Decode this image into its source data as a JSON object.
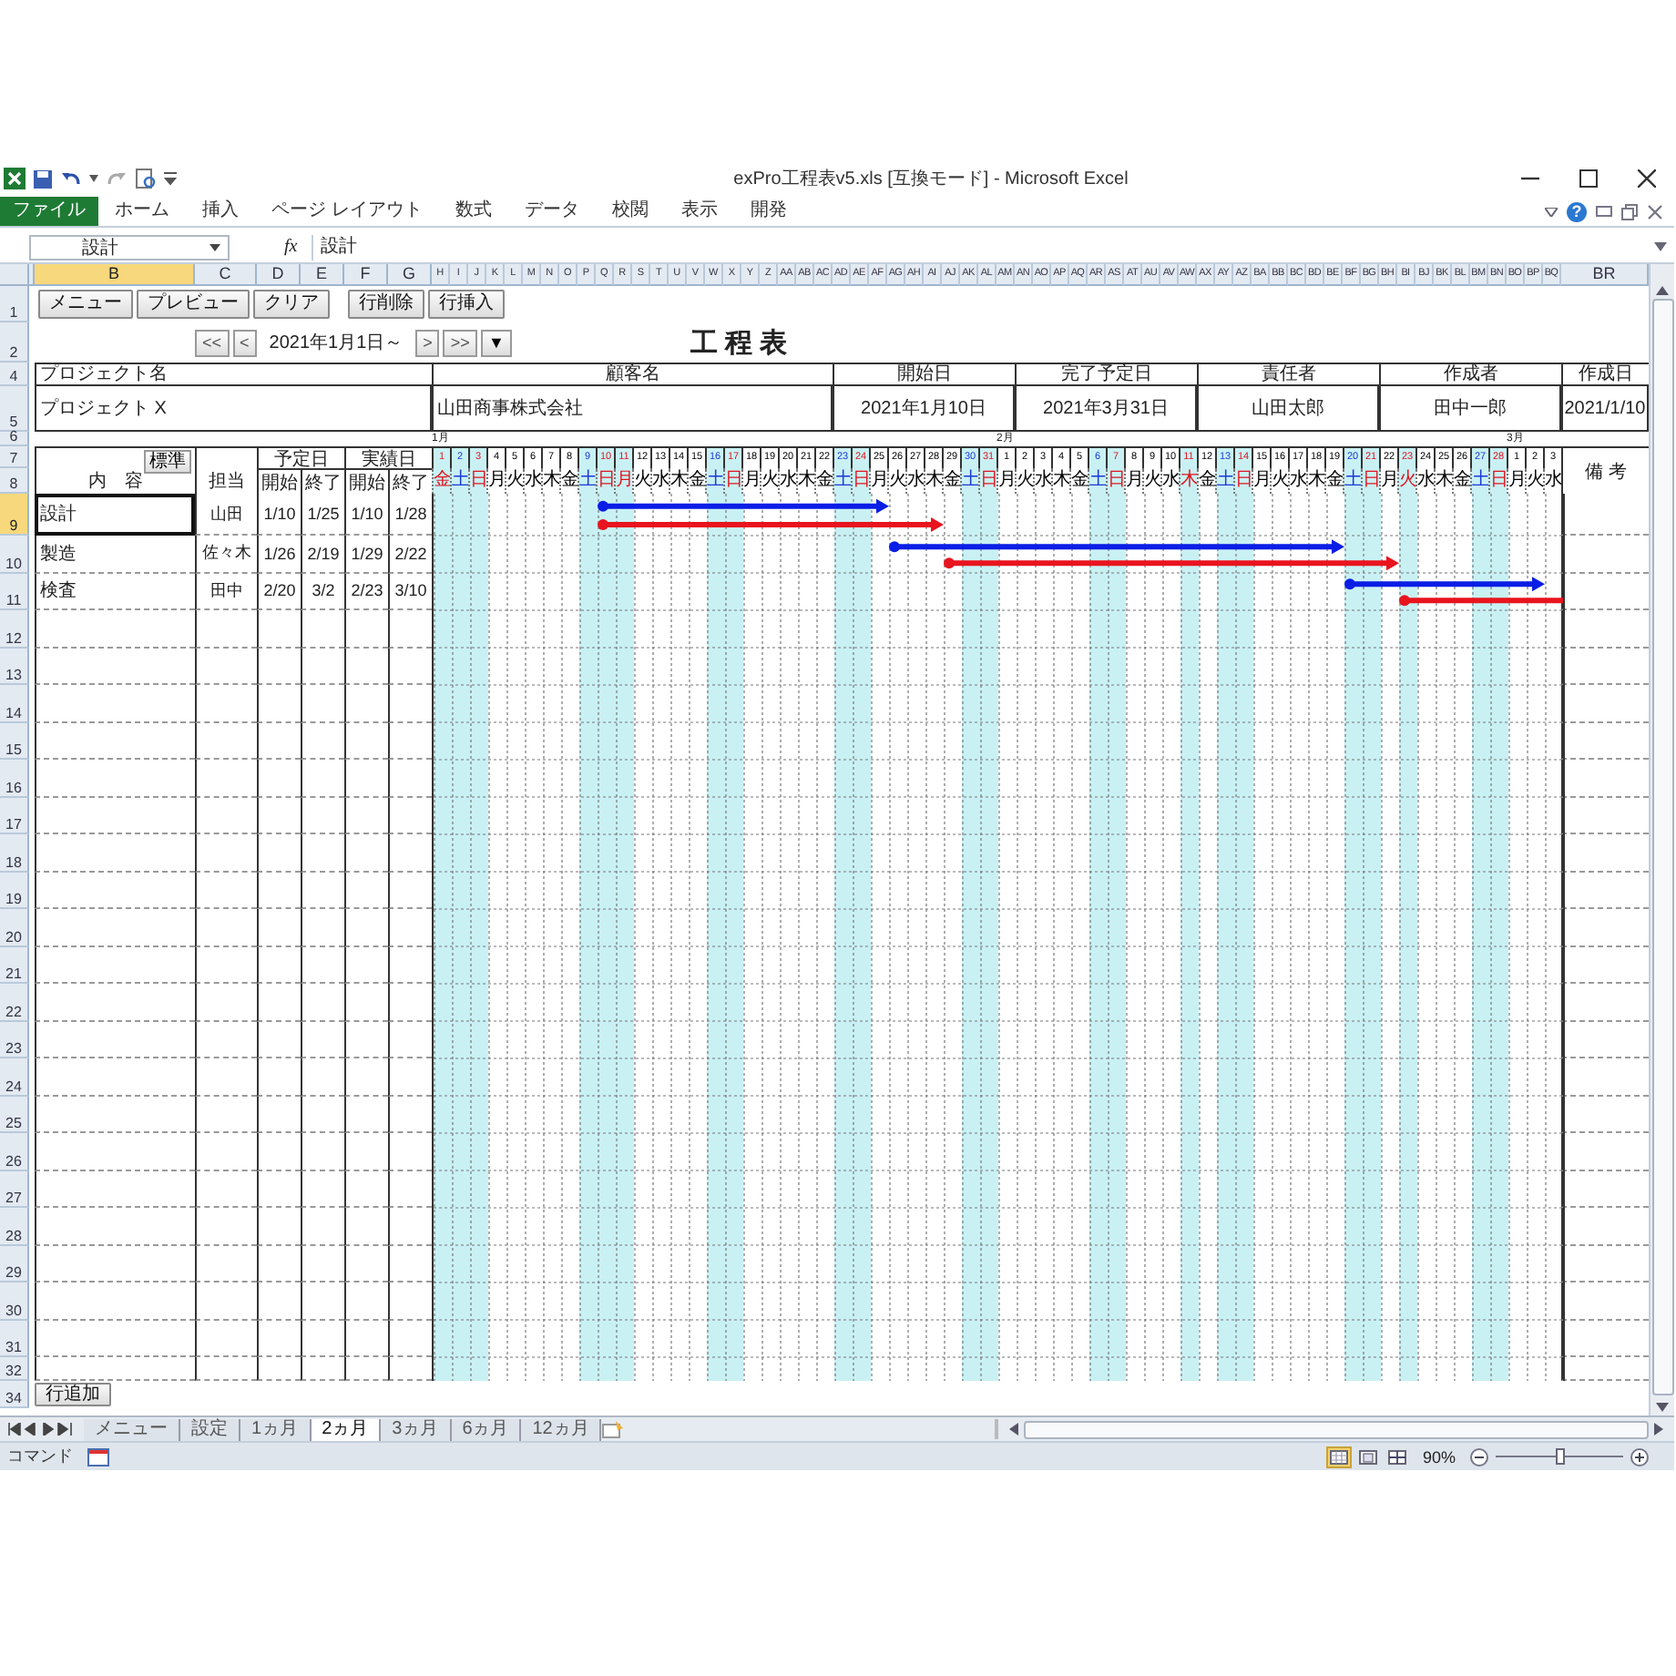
{
  "window": {
    "title": "exPro工程表v5.xls [互換モード] - Microsoft Excel"
  },
  "ribbon": {
    "tabs": [
      {
        "label": "ファイル",
        "kind": "file"
      },
      {
        "label": "ホーム",
        "kind": "tab"
      },
      {
        "label": "挿入",
        "kind": "tab"
      },
      {
        "label": "ページ レイアウト",
        "kind": "tab"
      },
      {
        "label": "数式",
        "kind": "tab"
      },
      {
        "label": "データ",
        "kind": "tab"
      },
      {
        "label": "校閲",
        "kind": "tab"
      },
      {
        "label": "表示",
        "kind": "tab"
      },
      {
        "label": "開発",
        "kind": "tab"
      }
    ],
    "help_label": "?"
  },
  "formula_bar": {
    "name_box": "設計",
    "fx_label": "fx",
    "formula": "設計"
  },
  "column_headers": [
    {
      "label": "B",
      "selected": true
    },
    {
      "label": "C",
      "selected": false
    },
    {
      "label": "D",
      "selected": false
    },
    {
      "label": "E",
      "selected": false
    },
    {
      "label": "F",
      "selected": false
    },
    {
      "label": "G",
      "selected": false
    }
  ],
  "last_column_header": {
    "label": "BR",
    "selected": false
  },
  "row_headers": [
    {
      "label": "1",
      "selected": false
    },
    {
      "label": "2",
      "selected": false
    },
    {
      "label": "4",
      "selected": false
    },
    {
      "label": "5",
      "selected": false
    },
    {
      "label": "6",
      "selected": false
    },
    {
      "label": "7",
      "selected": false
    },
    {
      "label": "8",
      "selected": false
    },
    {
      "label": "9",
      "selected": true
    },
    {
      "label": "10",
      "selected": false
    },
    {
      "label": "11",
      "selected": false
    },
    {
      "label": "12",
      "selected": false
    },
    {
      "label": "13",
      "selected": false
    },
    {
      "label": "14",
      "selected": false
    },
    {
      "label": "15",
      "selected": false
    },
    {
      "label": "16",
      "selected": false
    },
    {
      "label": "17",
      "selected": false
    },
    {
      "label": "18",
      "selected": false
    },
    {
      "label": "19",
      "selected": false
    },
    {
      "label": "20",
      "selected": false
    },
    {
      "label": "21",
      "selected": false
    },
    {
      "label": "22",
      "selected": false
    },
    {
      "label": "23",
      "selected": false
    },
    {
      "label": "24",
      "selected": false
    },
    {
      "label": "25",
      "selected": false
    },
    {
      "label": "26",
      "selected": false
    },
    {
      "label": "27",
      "selected": false
    },
    {
      "label": "28",
      "selected": false
    },
    {
      "label": "29",
      "selected": false
    },
    {
      "label": "30",
      "selected": false
    },
    {
      "label": "31",
      "selected": false
    },
    {
      "label": "32",
      "selected": false
    },
    {
      "label": "34",
      "selected": false
    }
  ],
  "toolbar_buttons": [
    "メニュー",
    "プレビュー",
    "クリア"
  ],
  "row_buttons": [
    "行削除",
    "行挿入"
  ],
  "navigation": {
    "first": "<<",
    "previous": "<",
    "date": "2021年1月1日～",
    "next": ">",
    "last": ">>",
    "dropdown": "▼"
  },
  "sheet_title": "工 程 表",
  "project_info": [
    {
      "label": "プロジェクト名",
      "value": "プロジェクト X"
    },
    {
      "label": "顧客名",
      "value": "山田商事株式会社"
    },
    {
      "label": "開始日",
      "value": "2021年1月10日"
    },
    {
      "label": "完了予定日",
      "value": "2021年3月31日"
    },
    {
      "label": "責任者",
      "value": "山田太郎"
    },
    {
      "label": "作成者",
      "value": "田中一郎"
    },
    {
      "label": "作成日",
      "value": "2021/1/10"
    }
  ],
  "table_header": {
    "content": "内　容",
    "standard_button": "標準",
    "owner": "担当",
    "planned": "予定日",
    "actual": "実績日",
    "plan_start": "開始",
    "plan_end": "終了",
    "actual_start": "開始",
    "actual_end": "終了",
    "remarks": "備 考"
  },
  "months": [
    {
      "label": "1月",
      "days": [
        {
          "day": "1",
          "weekday": "金",
          "column": "H",
          "kind": "holiday"
        },
        {
          "day": "2",
          "weekday": "土",
          "column": "I",
          "kind": "saturday"
        },
        {
          "day": "3",
          "weekday": "日",
          "column": "J",
          "kind": "holiday"
        },
        {
          "day": "4",
          "weekday": "月",
          "column": "K",
          "kind": "weekday"
        },
        {
          "day": "5",
          "weekday": "火",
          "column": "L",
          "kind": "weekday"
        },
        {
          "day": "6",
          "weekday": "水",
          "column": "M",
          "kind": "weekday"
        },
        {
          "day": "7",
          "weekday": "木",
          "column": "N",
          "kind": "weekday"
        },
        {
          "day": "8",
          "weekday": "金",
          "column": "O",
          "kind": "weekday"
        },
        {
          "day": "9",
          "weekday": "土",
          "column": "P",
          "kind": "saturday"
        },
        {
          "day": "10",
          "weekday": "日",
          "column": "Q",
          "kind": "holiday"
        },
        {
          "day": "11",
          "weekday": "月",
          "column": "R",
          "kind": "holiday"
        },
        {
          "day": "12",
          "weekday": "火",
          "column": "S",
          "kind": "weekday"
        },
        {
          "day": "13",
          "weekday": "水",
          "column": "T",
          "kind": "weekday"
        },
        {
          "day": "14",
          "weekday": "木",
          "column": "U",
          "kind": "weekday"
        },
        {
          "day": "15",
          "weekday": "金",
          "column": "V",
          "kind": "weekday"
        },
        {
          "day": "16",
          "weekday": "土",
          "column": "W",
          "kind": "saturday"
        },
        {
          "day": "17",
          "weekday": "日",
          "column": "X",
          "kind": "holiday"
        },
        {
          "day": "18",
          "weekday": "月",
          "column": "Y",
          "kind": "weekday"
        },
        {
          "day": "19",
          "weekday": "火",
          "column": "Z",
          "kind": "weekday"
        },
        {
          "day": "20",
          "weekday": "水",
          "column": "AA",
          "kind": "weekday"
        },
        {
          "day": "21",
          "weekday": "木",
          "column": "AB",
          "kind": "weekday"
        },
        {
          "day": "22",
          "weekday": "金",
          "column": "AC",
          "kind": "weekday"
        },
        {
          "day": "23",
          "weekday": "土",
          "column": "AD",
          "kind": "saturday"
        },
        {
          "day": "24",
          "weekday": "日",
          "column": "AE",
          "kind": "holiday"
        },
        {
          "day": "25",
          "weekday": "月",
          "column": "AF",
          "kind": "weekday"
        },
        {
          "day": "26",
          "weekday": "火",
          "column": "AG",
          "kind": "weekday"
        },
        {
          "day": "27",
          "weekday": "水",
          "column": "AH",
          "kind": "weekday"
        },
        {
          "day": "28",
          "weekday": "木",
          "column": "AI",
          "kind": "weekday"
        },
        {
          "day": "29",
          "weekday": "金",
          "column": "AJ",
          "kind": "weekday"
        },
        {
          "day": "30",
          "weekday": "土",
          "column": "AK",
          "kind": "saturday"
        },
        {
          "day": "31",
          "weekday": "日",
          "column": "AL",
          "kind": "holiday"
        }
      ]
    },
    {
      "label": "2月",
      "days": [
        {
          "day": "1",
          "weekday": "月",
          "column": "AM",
          "kind": "weekday"
        },
        {
          "day": "2",
          "weekday": "火",
          "column": "AN",
          "kind": "weekday"
        },
        {
          "day": "3",
          "weekday": "水",
          "column": "AO",
          "kind": "weekday"
        },
        {
          "day": "4",
          "weekday": "木",
          "column": "AP",
          "kind": "weekday"
        },
        {
          "day": "5",
          "weekday": "金",
          "column": "AQ",
          "kind": "weekday"
        },
        {
          "day": "6",
          "weekday": "土",
          "column": "AR",
          "kind": "saturday"
        },
        {
          "day": "7",
          "weekday": "日",
          "column": "AS",
          "kind": "holiday"
        },
        {
          "day": "8",
          "weekday": "月",
          "column": "AT",
          "kind": "weekday"
        },
        {
          "day": "9",
          "weekday": "火",
          "column": "AU",
          "kind": "weekday"
        },
        {
          "day": "10",
          "weekday": "水",
          "column": "AV",
          "kind": "weekday"
        },
        {
          "day": "11",
          "weekday": "木",
          "column": "AW",
          "kind": "holiday"
        },
        {
          "day": "12",
          "weekday": "金",
          "column": "AX",
          "kind": "weekday"
        },
        {
          "day": "13",
          "weekday": "土",
          "column": "AY",
          "kind": "saturday"
        },
        {
          "day": "14",
          "weekday": "日",
          "column": "AZ",
          "kind": "holiday"
        },
        {
          "day": "15",
          "weekday": "月",
          "column": "BA",
          "kind": "weekday"
        },
        {
          "day": "16",
          "weekday": "火",
          "column": "BB",
          "kind": "weekday"
        },
        {
          "day": "17",
          "weekday": "水",
          "column": "BC",
          "kind": "weekday"
        },
        {
          "day": "18",
          "weekday": "木",
          "column": "BD",
          "kind": "weekday"
        },
        {
          "day": "19",
          "weekday": "金",
          "column": "BE",
          "kind": "weekday"
        },
        {
          "day": "20",
          "weekday": "土",
          "column": "BF",
          "kind": "saturday"
        },
        {
          "day": "21",
          "weekday": "日",
          "column": "BG",
          "kind": "holiday"
        },
        {
          "day": "22",
          "weekday": "月",
          "column": "BH",
          "kind": "weekday"
        },
        {
          "day": "23",
          "weekday": "火",
          "column": "BI",
          "kind": "holiday"
        },
        {
          "day": "24",
          "weekday": "水",
          "column": "BJ",
          "kind": "weekday"
        },
        {
          "day": "25",
          "weekday": "木",
          "column": "BK",
          "kind": "weekday"
        },
        {
          "day": "26",
          "weekday": "金",
          "column": "BL",
          "kind": "weekday"
        },
        {
          "day": "27",
          "weekday": "土",
          "column": "BM",
          "kind": "saturday"
        },
        {
          "day": "28",
          "weekday": "日",
          "column": "BN",
          "kind": "holiday"
        }
      ]
    },
    {
      "label": "3月",
      "days": [
        {
          "day": "1",
          "weekday": "月",
          "column": "BO",
          "kind": "weekday"
        },
        {
          "day": "2",
          "weekday": "火",
          "column": "BP",
          "kind": "weekday"
        },
        {
          "day": "3",
          "weekday": "水",
          "column": "BQ",
          "kind": "weekday"
        }
      ]
    }
  ],
  "tasks": [
    {
      "content": "設計",
      "owner": "山田",
      "plan_start": "1/10",
      "plan_end": "1/25",
      "actual_start": "1/10",
      "actual_end": "1/28",
      "selected": true
    },
    {
      "content": "製造",
      "owner": "佐々木",
      "plan_start": "1/26",
      "plan_end": "2/19",
      "actual_start": "1/29",
      "actual_end": "2/22",
      "selected": false
    },
    {
      "content": "検査",
      "owner": "田中",
      "plan_start": "2/20",
      "plan_end": "3/2",
      "actual_start": "2/23",
      "actual_end": "3/10",
      "selected": false
    }
  ],
  "add_row_button": "行追加",
  "sheet_tabs": [
    {
      "label": "メニュー",
      "selected": false
    },
    {
      "label": "設定",
      "selected": false
    },
    {
      "label": "1ヵ月",
      "selected": false
    },
    {
      "label": "2ヵ月",
      "selected": true
    },
    {
      "label": "3ヵ月",
      "selected": false
    },
    {
      "label": "6ヵ月",
      "selected": false
    },
    {
      "label": "12ヵ月",
      "selected": false
    }
  ],
  "status_bar": {
    "mode": "コマンド",
    "view_buttons": [
      {
        "kind": "normal",
        "selected": true
      },
      {
        "kind": "page_layout",
        "selected": false
      },
      {
        "kind": "page_break",
        "selected": false
      }
    ],
    "zoom": "90%",
    "zoom_slider": {
      "level": 0.5
    }
  }
}
